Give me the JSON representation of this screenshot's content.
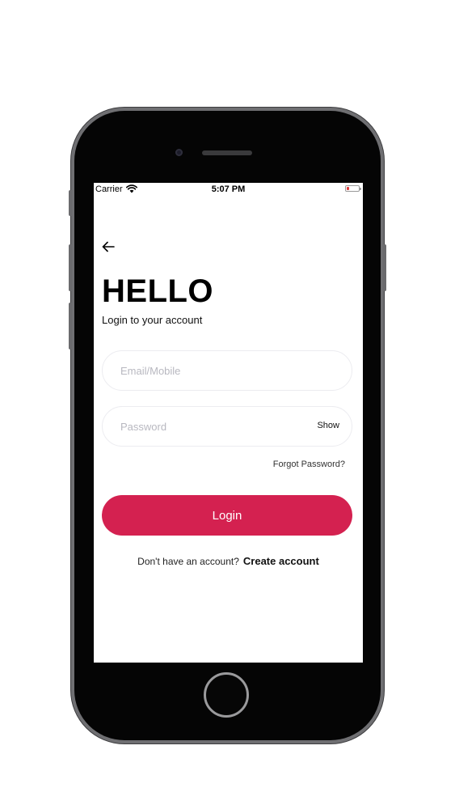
{
  "status_bar": {
    "carrier": "Carrier",
    "time": "5:07 PM",
    "battery_color": "#e03a3a"
  },
  "header": {
    "back_icon": "arrow-left-icon",
    "title": "HELLO",
    "subtitle": "Login to your account"
  },
  "form": {
    "email_placeholder": "Email/Mobile",
    "email_value": "",
    "password_placeholder": "Password",
    "password_value": "",
    "show_label": "Show",
    "forgot_label": "Forgot Password?",
    "login_label": "Login"
  },
  "footer": {
    "prompt": "Don't have an account?",
    "create_label": "Create account"
  },
  "colors": {
    "accent": "#d42150",
    "background": "#ffffff",
    "phone_body": "#050505"
  }
}
